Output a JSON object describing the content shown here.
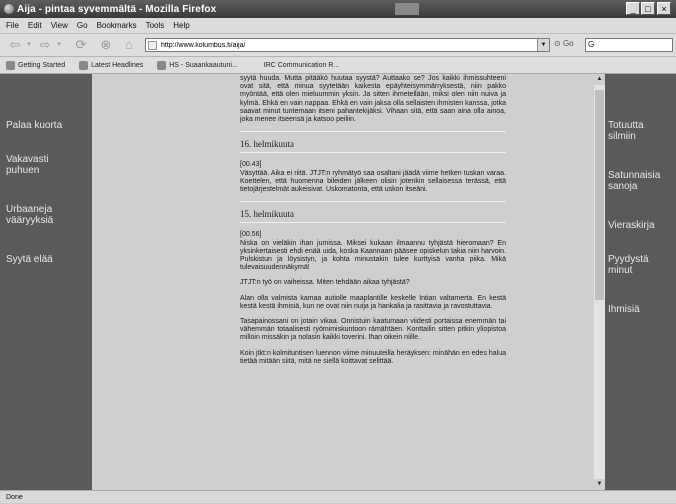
{
  "window": {
    "title": "Aija - pintaa syvemmältä - Mozilla Firefox"
  },
  "menu": [
    "File",
    "Edit",
    "View",
    "Go",
    "Bookmarks",
    "Tools",
    "Help"
  ],
  "toolbar": {
    "url": "http://www.kolumbus.fi/aija/",
    "go_label": "Go",
    "search_placeholder": "G"
  },
  "bookmarks": [
    {
      "label": "Getting Started",
      "icon": "firefox-icon"
    },
    {
      "label": "Latest Headlines",
      "icon": "rss-icon"
    },
    {
      "label": "HS - Suaankaautuni...",
      "icon": "hs-icon"
    },
    {
      "label": "IRC Communication R...",
      "icon": "blank-icon"
    }
  ],
  "left_nav": [
    "Palaa kuorta",
    "Vakavasti puhuen",
    "Urbaaneja vääryyksiä",
    "Syytä elää"
  ],
  "right_nav": [
    "Totuutta silmiin",
    "Satunnaisia sanoja",
    "Vieraskirja",
    "Pyydystä minut",
    "Ihmisiä"
  ],
  "article": {
    "intro": "syytä huuda. Mutta pitääkö huutaa syystä? Auttaako se? Jos kaikki ihmissuhteeni ovat sitä, että minua syytetään kaikesta epäyhteisymmärryksestä, niin pakko myöntää, että olen mieluummin yksin. Ja sitten ihmetellään, miksi olen niin nuiva ja kylmä. Ehkä en vain nappaa. Ehkä en vain jaksa olla sellaisten ihmisten kanssa, jotka saavat minut tuntemaan itseni pahantekijäksi. Vihaan sitä, että saan aina olla ainoa, joka menee itseensä ja katsoo peiliin.",
    "entries": [
      {
        "date": "16. helmikuuta",
        "time": "[00.43]",
        "paragraphs": [
          "Väsyttää. Aika ei riitä. JTJT:n ryhmätyö saa osaltani jäädä viime hetken tuskan varaa. Koettelen, että huomenna bileiden jälkeen olisin jotenkin sellaisessa terässä, että tietojärjestelmät aukeisivat. Uskomatonta, että uskon itseäni."
        ]
      },
      {
        "date": "15. helmikuuta",
        "time": "[00.56]",
        "paragraphs": [
          "Niska on vieläkin ihan jumissa. Miksei kukaan ilmaannu tyhjästä hieromaan? En yksinkertaisesti ehdi enää uida, koska Kaannaan pääsee opiskelun takia niin harvoin. Pulskistun ja löysistyn, ja kohta minustakin tulee kurttyisä vanha piika. Mikä tulevaisuudennäkymä!",
          "JTJT:n työ on vaiheissa. Miten tehdään aikaa tyhjästä?",
          "Alan olla valmista kamaa autiolle maaplantille keskelle Intian valtamerta. En kestä kestä kestä ihmisiä, kun ne ovat niin nuija ja hankalia ja rasittavia ja ravostuttavia.",
          "Tasapainossani on jotain vikaa. Onnistuin kaatumaan viidesti portaissa enemmän tai vähemmän totaalisesti ryömimiskuntoon rämähtäen. Konttailin sitten pitkin yliopistoa milloin missäkin ja nolasin kaikki toverini. Ihan oikein niille.",
          "Koin jtkt:n kolmituntisen luennon viime minuuteilla heräyksen: minähän en edes halua tietää mitään siitä, mitä ne siellä koittavat selittää."
        ]
      }
    ]
  },
  "status": "Done"
}
